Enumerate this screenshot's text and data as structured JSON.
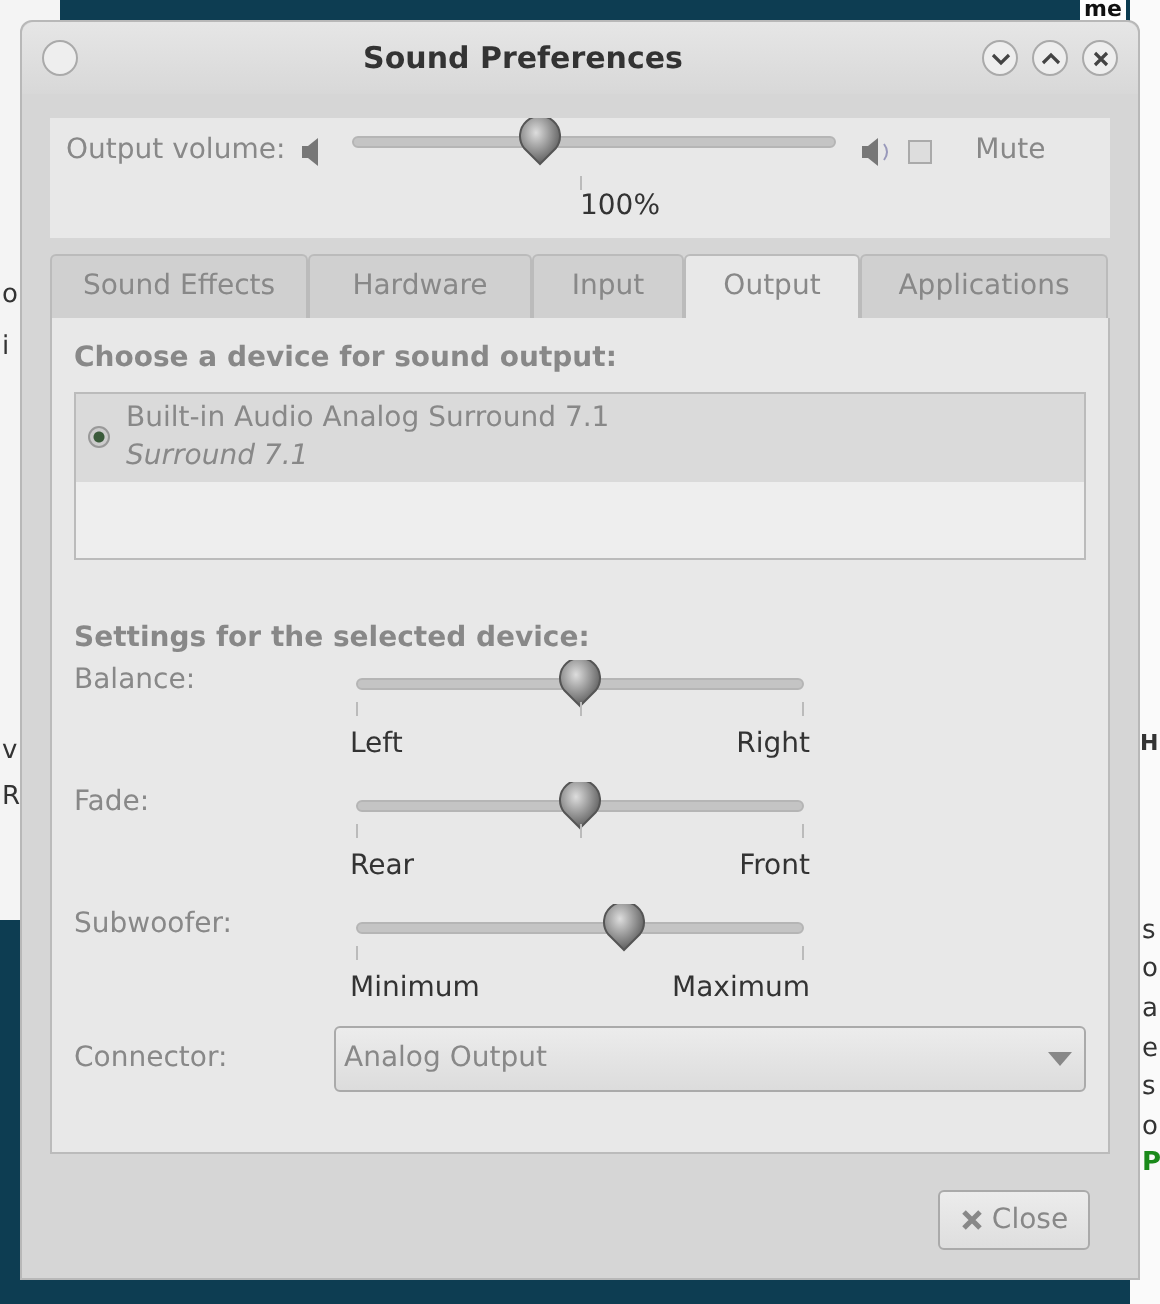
{
  "background": {
    "left_fragments": [
      "o",
      "i",
      "v",
      "R"
    ],
    "right_fragments": [
      "H",
      "s",
      "o",
      "a",
      "e",
      "s",
      "o",
      "P"
    ],
    "top_right_fragment": "me"
  },
  "window": {
    "title": "Sound Preferences"
  },
  "volume": {
    "label": "Output volume:",
    "level": 0.39,
    "reading": "100%",
    "mute": {
      "label": "Mute",
      "checked": false
    }
  },
  "tabs": [
    {
      "label": "Sound Effects",
      "selected": false
    },
    {
      "label": "Hardware",
      "selected": false
    },
    {
      "label": "Input",
      "selected": false
    },
    {
      "label": "Output",
      "selected": true
    },
    {
      "label": "Applications",
      "selected": false
    }
  ],
  "device_heading": "Choose a device for sound output:",
  "devices": [
    {
      "name": "Built-in Audio Analog Surround 7.1",
      "profile": "Surround 7.1",
      "selected": true
    }
  ],
  "settings_heading": "Settings for the selected device:",
  "sliders": [
    {
      "label": "Balance:",
      "level": 0.5,
      "min_label": "Left",
      "max_label": "Right",
      "center_mark": true
    },
    {
      "label": "Fade:",
      "level": 0.5,
      "min_label": "Rear",
      "max_label": "Front",
      "center_mark": true
    },
    {
      "label": "Subwoofer:",
      "level": 0.6,
      "min_label": "Minimum",
      "max_label": "Maximum",
      "center_mark": false
    }
  ],
  "connector": {
    "label": "Connector:",
    "value": "Analog Output"
  },
  "close_button": "Close"
}
